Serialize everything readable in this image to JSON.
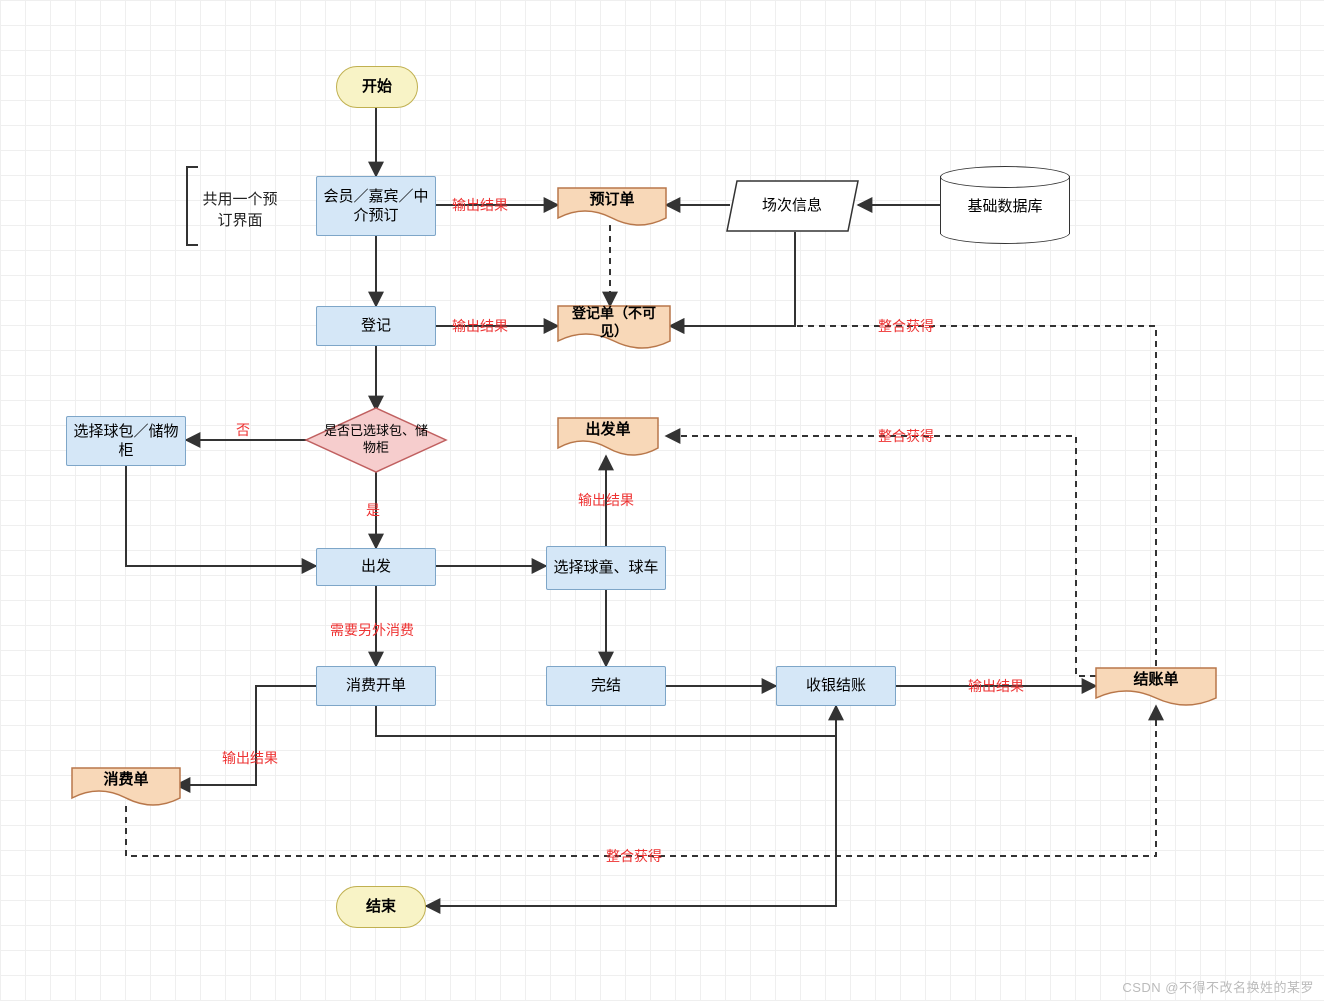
{
  "terminator": {
    "start": "开始",
    "end": "结束"
  },
  "process": {
    "booking": "会员／嘉宾／中介预订",
    "register": "登记",
    "select_bag": "选择球包／储物柜",
    "depart": "出发",
    "select_caddie": "选择球童、球车",
    "consume_order": "消费开单",
    "complete": "完结",
    "cashier": "收银结账"
  },
  "document": {
    "booking_doc": "预订单",
    "register_doc": "登记单（不可见）",
    "depart_doc": "出发单",
    "consume_doc": "消费单",
    "checkout_doc": "结账单"
  },
  "data": {
    "session_info": "场次信息",
    "base_db": "基础数据库"
  },
  "decision": {
    "selected_bag": "是否已选球包、储物柜"
  },
  "edge_label": {
    "output_result": "输出结果",
    "integrate_obtain": "整合获得",
    "no": "否",
    "yes": "是",
    "extra_consume": "需要另外消费"
  },
  "annotation": {
    "shared_booking_ui": "共用一个预订界面"
  },
  "watermark": "CSDN @不得不改名换姓的某罗",
  "colors": {
    "process_fill": "#d5e7f7",
    "process_stroke": "#7ea6c8",
    "doc_fill": "#f8d8b8",
    "doc_stroke": "#b8774a",
    "terminator_fill": "#f8f3c6",
    "terminator_stroke": "#c0b050",
    "decision_fill": "#f6cdcd",
    "decision_stroke": "#c06060",
    "label_red": "#ee3333"
  }
}
